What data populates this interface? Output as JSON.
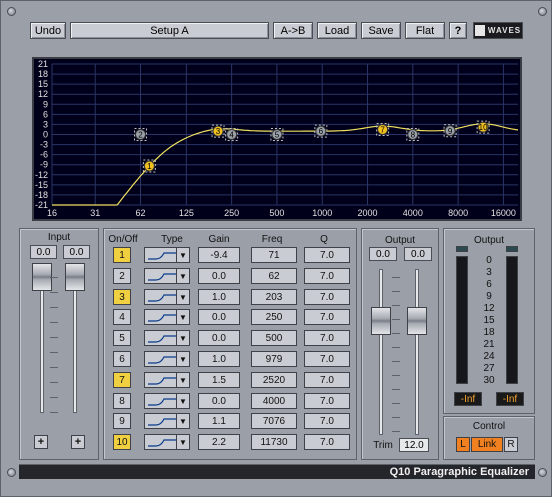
{
  "toolbar": {
    "undo_label": "Undo",
    "setup_label": "Setup A",
    "ab_label": "A->B",
    "load_label": "Load",
    "save_label": "Save",
    "flat_label": "Flat",
    "help_label": "?",
    "logo_text": "WAVES"
  },
  "graph": {
    "y_ticks": [
      "21",
      "18",
      "15",
      "12",
      "9",
      "6",
      "3",
      "0",
      "-3",
      "-6",
      "-9",
      "-12",
      "-15",
      "-18",
      "-21"
    ],
    "x_ticks": [
      "16",
      "31",
      "62",
      "125",
      "250",
      "500",
      "1000",
      "2000",
      "4000",
      "8000",
      "16000"
    ],
    "curve_color": "#f0e060",
    "grid_color": "#2a3566",
    "bg_color": "#00001a"
  },
  "input": {
    "label": "Input",
    "left_value": "0.0",
    "right_value": "0.0",
    "plus_left": "+",
    "plus_right": "+"
  },
  "bands_header": {
    "onoff": "On/Off",
    "type": "Type",
    "gain": "Gain",
    "freq": "Freq",
    "q": "Q"
  },
  "bands": [
    {
      "num": "1",
      "on": true,
      "gain": "-9.4",
      "freq": "71",
      "q": "7.0"
    },
    {
      "num": "2",
      "on": false,
      "gain": "0.0",
      "freq": "62",
      "q": "7.0"
    },
    {
      "num": "3",
      "on": true,
      "gain": "1.0",
      "freq": "203",
      "q": "7.0"
    },
    {
      "num": "4",
      "on": false,
      "gain": "0.0",
      "freq": "250",
      "q": "7.0"
    },
    {
      "num": "5",
      "on": false,
      "gain": "0.0",
      "freq": "500",
      "q": "7.0"
    },
    {
      "num": "6",
      "on": false,
      "gain": "1.0",
      "freq": "979",
      "q": "7.0"
    },
    {
      "num": "7",
      "on": true,
      "gain": "1.5",
      "freq": "2520",
      "q": "7.0"
    },
    {
      "num": "8",
      "on": false,
      "gain": "0.0",
      "freq": "4000",
      "q": "7.0"
    },
    {
      "num": "9",
      "on": false,
      "gain": "1.1",
      "freq": "7076",
      "q": "7.0"
    },
    {
      "num": "10",
      "on": true,
      "gain": "2.2",
      "freq": "11730",
      "q": "7.0"
    }
  ],
  "output": {
    "label": "Output",
    "left_value": "0.0",
    "right_value": "0.0",
    "trim_label": "Trim",
    "trim_value": "12.0"
  },
  "meter": {
    "label": "Output",
    "scale": [
      "0",
      "3",
      "6",
      "9",
      "12",
      "15",
      "18",
      "21",
      "24",
      "27",
      "30"
    ],
    "left_peak": "-Inf",
    "right_peak": "-Inf"
  },
  "control": {
    "label": "Control",
    "l_label": "L",
    "link_label": "Link",
    "r_label": "R"
  },
  "footer": {
    "title": "Q10 Paragraphic Equalizer"
  },
  "colors": {
    "band_on": "#f0d040",
    "band_off": "#c9ccd2",
    "link_active": "#f08020"
  }
}
